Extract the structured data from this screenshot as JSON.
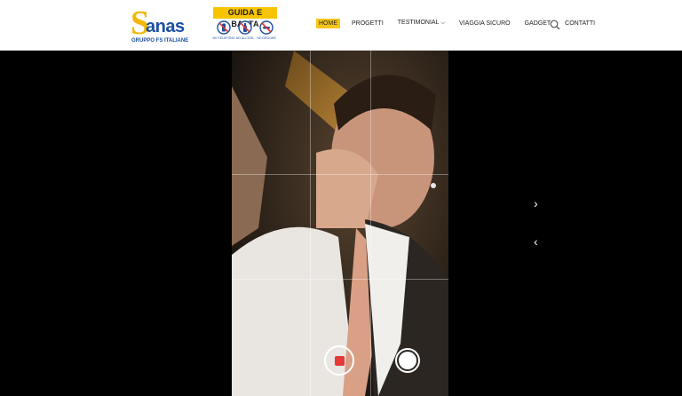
{
  "header": {
    "logo": {
      "letter": "S",
      "word": "anas",
      "subtitle": "GRUPPO FS ITALIANE"
    },
    "campaign": {
      "title": "GUIDA E BASTA",
      "icons": [
        {
          "icon": "no-phone-icon",
          "label": "NO TELEFONO"
        },
        {
          "icon": "no-alcohol-icon",
          "label": "NO ALCOOL"
        },
        {
          "icon": "no-drugs-icon",
          "label": "NO DROGHE"
        }
      ]
    },
    "nav": [
      {
        "label": "HOME",
        "active": true
      },
      {
        "label": "PROGETTI"
      },
      {
        "label": "TESTIMONIAL",
        "has_dropdown": true
      },
      {
        "label": "VIAGGIA SICURO"
      },
      {
        "label": "GADGET"
      },
      {
        "label": "CONTATTI"
      }
    ],
    "search_icon": "search-icon"
  },
  "colors": {
    "accent": "#f7c51a",
    "brand_blue": "#1a4fa0",
    "brand_yellow": "#f2b705",
    "record": "#e53935",
    "background": "#000000"
  },
  "carousel": {
    "next_icon": "chevron-right-icon",
    "prev_icon": "chevron-left-icon",
    "next_glyph": "›",
    "prev_glyph": "‹"
  },
  "video": {
    "record_icon": "record-icon",
    "shutter_icon": "shutter-icon"
  }
}
